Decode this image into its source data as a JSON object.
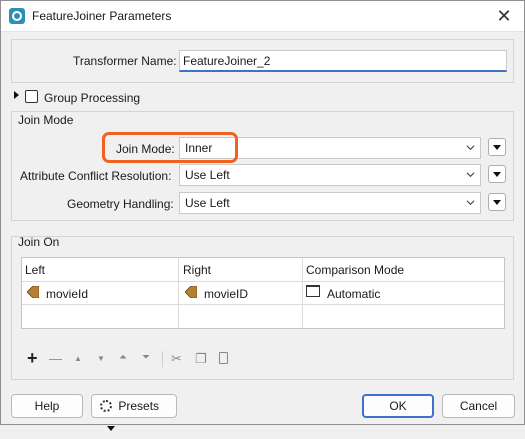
{
  "window": {
    "title": "FeatureJoiner Parameters",
    "close_glyph": "✕"
  },
  "transformer": {
    "label": "Transformer Name:",
    "value": "FeatureJoiner_2"
  },
  "group_processing": {
    "label": "Group Processing",
    "checked": false
  },
  "join_mode_section": {
    "title": "Join Mode",
    "join_mode": {
      "label": "Join Mode:",
      "value": "Inner"
    },
    "attribute_conflict": {
      "label": "Attribute Conflict Resolution:",
      "value": "Use Left"
    },
    "geometry_handling": {
      "label": "Geometry Handling:",
      "value": "Use Left"
    }
  },
  "join_on_section": {
    "title": "Join On",
    "columns": [
      "Left",
      "Right",
      "Comparison Mode"
    ],
    "rows": [
      {
        "left": "movieId",
        "right": "movieID",
        "mode": "Automatic"
      }
    ],
    "toolbar_icons": [
      "add-icon",
      "remove-icon",
      "move-up-icon",
      "move-down-icon",
      "move-top-icon",
      "move-bottom-icon",
      "cut-icon",
      "copy-icon",
      "paste-icon"
    ],
    "toolbar_glyphs": {
      "add": "+",
      "remove": "—",
      "up": "▲",
      "down": "▼",
      "top": "⏶",
      "bottom": "⏷",
      "cut": "✂",
      "copy": "❐",
      "paste": "📋"
    }
  },
  "footer": {
    "help": "Help",
    "presets": "Presets",
    "ok": "OK",
    "cancel": "Cancel"
  },
  "colors": {
    "accent": "#3d73c6",
    "highlight": "#f0621d",
    "attr_icon": "#b5802f"
  }
}
